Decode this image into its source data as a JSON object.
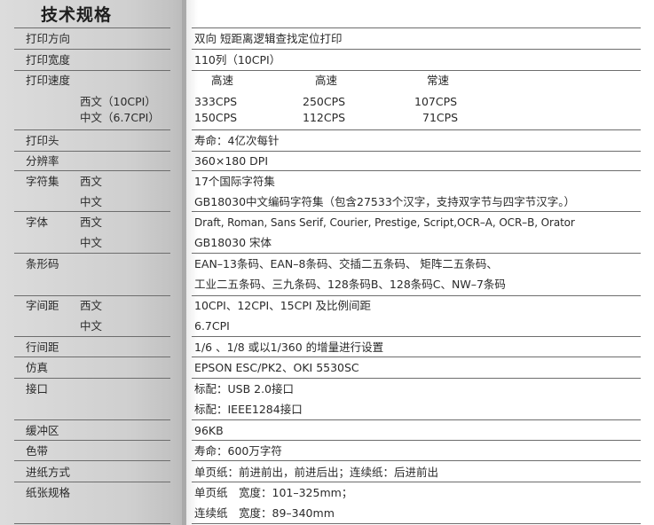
{
  "title": "技术规格",
  "rows": {
    "direction": {
      "label": "打印方向",
      "value": "双向 短距离逻辑查找定位打印"
    },
    "width": {
      "label": "打印宽度",
      "value": "110列（10CPI）"
    },
    "speed": {
      "label": "打印速度",
      "headers": [
        "高速",
        "高速",
        "常速"
      ],
      "western": {
        "label": "西文（10CPI）",
        "values": [
          "333CPS",
          "250CPS",
          "107CPS"
        ]
      },
      "chinese": {
        "label": "中文（6.7CPI）",
        "values": [
          "150CPS",
          "112CPS",
          "71CPS"
        ]
      }
    },
    "head": {
      "label": "打印头",
      "value": "寿命：4亿次每针"
    },
    "resolution": {
      "label": "分辨率",
      "value": "360×180 DPI"
    },
    "charset": {
      "label": "字符集",
      "sub_western": "西文",
      "sub_chinese": "中文",
      "western": "17个国际字符集",
      "chinese": "GB18030中文编码字符集（包含27533个汉字，支持双字节与四字节汉字。）"
    },
    "font": {
      "label": "字体",
      "sub_western": "西文",
      "sub_chinese": "中文",
      "western": "Draft, Roman, Sans Serif, Courier, Prestige, Script,OCR–A, OCR–B, Orator",
      "chinese": "GB18030 宋体"
    },
    "barcode": {
      "label": "条形码",
      "line1": "EAN–13条码、EAN–8条码、交插二五条码、 矩阵二五条码、",
      "line2": "工业二五条码、三九条码、128条码B、128条码C、NW–7条码"
    },
    "spacing": {
      "label": "字间距",
      "sub_western": "西文",
      "sub_chinese": "中文",
      "western": "10CPI、12CPI、15CPI 及比例间距",
      "chinese": "6.7CPI"
    },
    "linespacing": {
      "label": "行间距",
      "value": "1/6 、1/8 或以1/360 的增量进行设置"
    },
    "emulation": {
      "label": "仿真",
      "value": "EPSON ESC/PK2、OKI 5530SC"
    },
    "interface": {
      "label": "接口",
      "line1": "标配：USB 2.0接口",
      "line2": "标配：IEEE1284接口"
    },
    "buffer": {
      "label": "缓冲区",
      "value": "96KB"
    },
    "ribbon": {
      "label": "色带",
      "value": "寿命：600万字符"
    },
    "feed": {
      "label": "进纸方式",
      "value": "单页纸：前进前出，前进后出；连续纸：后进前出"
    },
    "paper": {
      "label": "纸张规格",
      "line1": "单页纸　宽度：101–325mm；",
      "line2": "连续纸　宽度：89–340mm"
    }
  }
}
